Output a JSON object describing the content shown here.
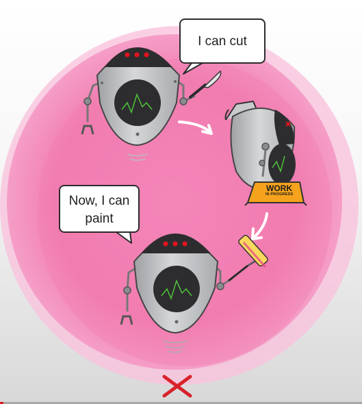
{
  "bubbles": {
    "cut": "I can cut",
    "paint_line1": "Now, I can",
    "paint_line2": "paint"
  },
  "sign": {
    "line1": "WORK",
    "line2": "IN PROGRESS"
  },
  "colors": {
    "blob": "#f17fb1",
    "accent": "#e3141e",
    "robot_body": "#c9cacc",
    "sign": "#f5a21d"
  },
  "icons": [
    "scalpel-icon",
    "curved-arrow-icon",
    "work-in-progress-sign-icon",
    "paint-roller-icon",
    "close-icon"
  ],
  "video_progress": 0.01
}
